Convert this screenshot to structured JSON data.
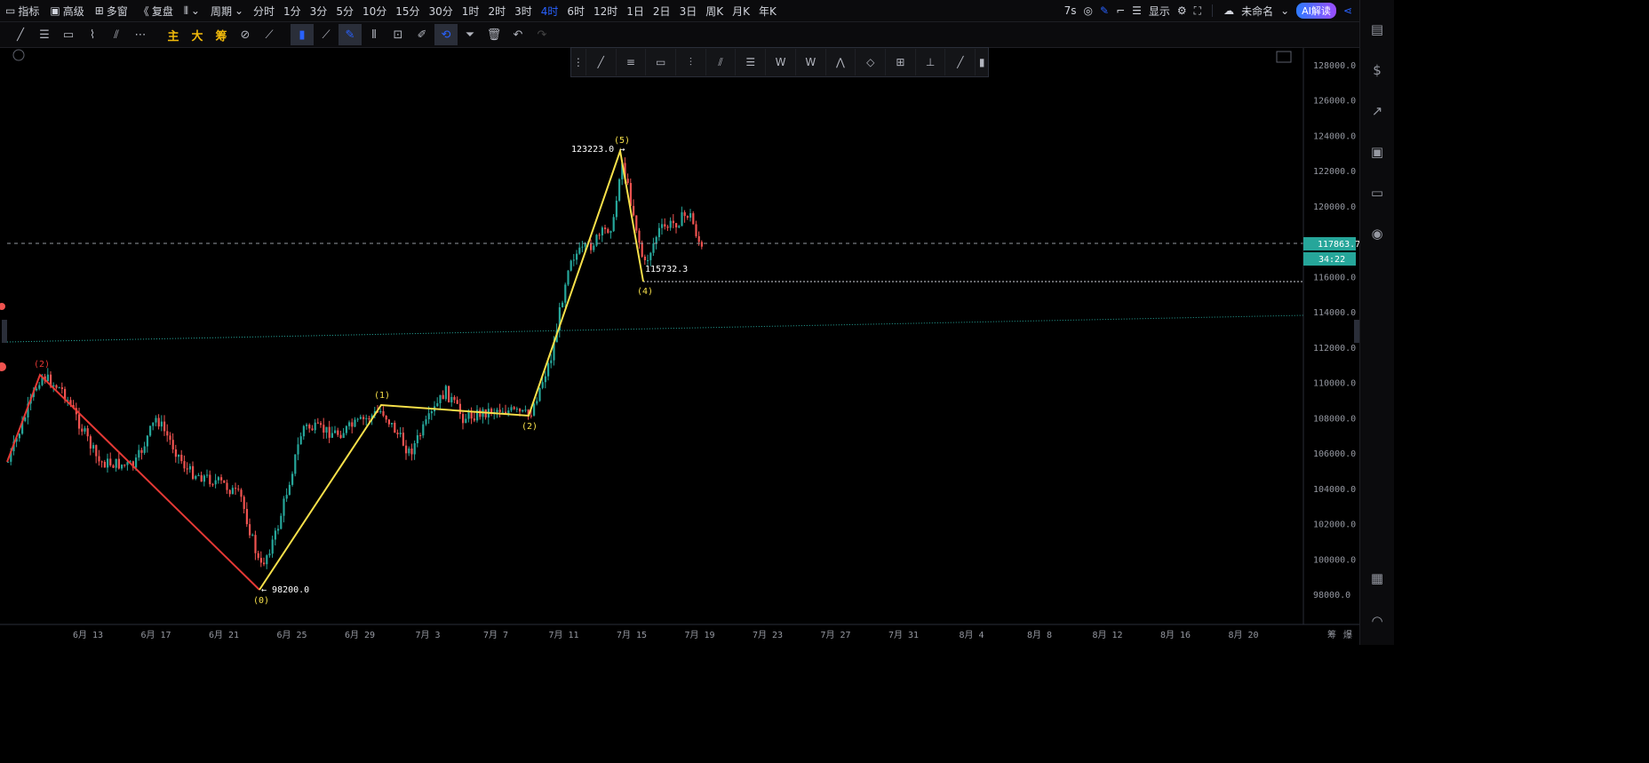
{
  "topbar": {
    "indicators": "指标",
    "advanced": "高级",
    "multiwindow": "多窗",
    "replay": "复盘",
    "period_label": "周期",
    "periods": [
      "分时",
      "1分",
      "3分",
      "5分",
      "10分",
      "15分",
      "30分",
      "1时",
      "2时",
      "3时",
      "4时",
      "6时",
      "12时",
      "1日",
      "2日",
      "3日",
      "周K",
      "月K",
      "年K"
    ],
    "active_period": "4时",
    "countdown_short": "7s",
    "display": "显示",
    "unnamed": "未命名",
    "ai": "AI解读"
  },
  "toolbar2": {
    "main_label": "主",
    "big_label": "大",
    "chip_label": "筹"
  },
  "chart": {
    "price_axis": [
      "128000.0",
      "126000.0",
      "124000.0",
      "122000.0",
      "120000.0",
      "118000.0",
      "116000.0",
      "114000.0",
      "112000.0",
      "110000.0",
      "108000.0",
      "106000.0",
      "104000.0",
      "102000.0",
      "100000.0",
      "98000.0"
    ],
    "date_axis": [
      "6月 13",
      "6月 17",
      "6月 21",
      "6月 25",
      "6月 29",
      "7月 3",
      "7月 7",
      "7月 11",
      "7月 15",
      "7月 19",
      "7月 23",
      "7月 27",
      "7月 31",
      "8月 4",
      "8月 8",
      "8月 12",
      "8月 16",
      "8月 20"
    ],
    "current_price": "117863.7",
    "countdown": "34:22",
    "high_label": "123223.0",
    "low_label": "98200.0",
    "support_label": "115732.3",
    "wave_labels": [
      "(2)",
      "(0)",
      "(1)",
      "(2)",
      "(5)",
      "(4)"
    ],
    "axis_corner": [
      "筹",
      "爆"
    ],
    "colors": {
      "up": "#26a69a",
      "down": "#ef5350",
      "wave_yellow": "#f7e04a",
      "wave_red": "#e53935",
      "price_tag": "#26a69a",
      "active": "#2962ff"
    }
  }
}
